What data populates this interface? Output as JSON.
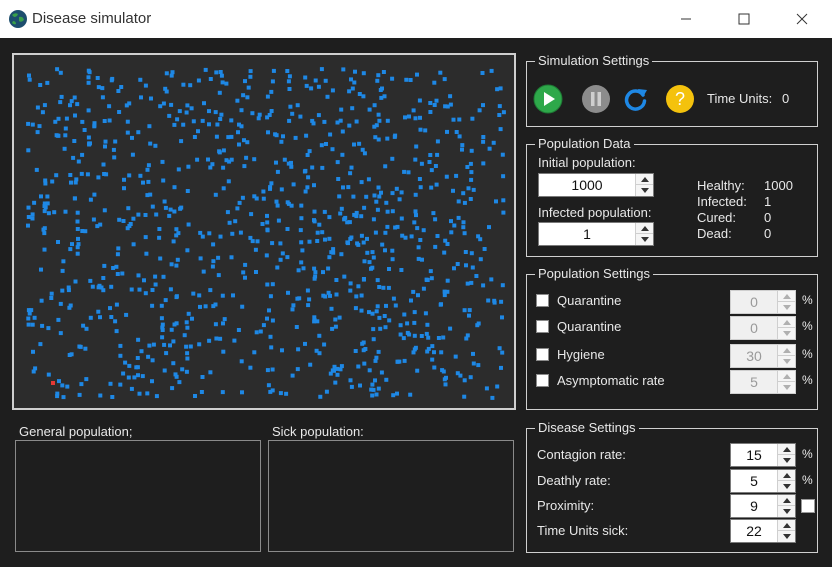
{
  "window": {
    "title": "Disease simulator"
  },
  "simulation": {
    "background_color": "#2c2c2c",
    "healthy_color": "#1e88e5",
    "infected_color": "#e53935",
    "healthy_shown": 1000,
    "infected_shown": 1
  },
  "lists": {
    "general_label": "General population;",
    "sick_label": "Sick population:"
  },
  "simulation_settings": {
    "title": "Simulation Settings",
    "play_icon": "play-icon",
    "pause_icon": "pause-icon",
    "reset_icon": "refresh-icon",
    "help_icon": "help-icon",
    "help_glyph": "?",
    "time_units_label": "Time Units:",
    "time_units_value": "0"
  },
  "population_data": {
    "title": "Population Data",
    "initial_label": "Initial population:",
    "initial_value": "1000",
    "infected_label": "Infected population:",
    "infected_value": "1",
    "stats": [
      {
        "label": "Healthy:",
        "value": "1000"
      },
      {
        "label": "Infected:",
        "value": "1"
      },
      {
        "label": "Cured:",
        "value": "0"
      },
      {
        "label": "Dead:",
        "value": "0"
      }
    ]
  },
  "population_settings": {
    "title": "Population Settings",
    "rows": [
      {
        "label": "Quarantine",
        "value": "0",
        "unit": "%",
        "checked": false
      },
      {
        "label": "Quarantine",
        "value": "0",
        "unit": "%",
        "checked": false
      },
      {
        "label": "Hygiene",
        "value": "30",
        "unit": "%",
        "checked": false
      },
      {
        "label": "Asymptomatic rate",
        "value": "5",
        "unit": "%",
        "checked": false
      }
    ]
  },
  "disease_settings": {
    "title": "Disease Settings",
    "rows": [
      {
        "label": "Contagion rate:",
        "value": "15",
        "unit": "%"
      },
      {
        "label": "Deathly rate:",
        "value": "5",
        "unit": "%"
      },
      {
        "label": "Proximity:",
        "value": "9",
        "unit": ""
      },
      {
        "label": "Time Units sick:",
        "value": "22",
        "unit": ""
      }
    ]
  }
}
